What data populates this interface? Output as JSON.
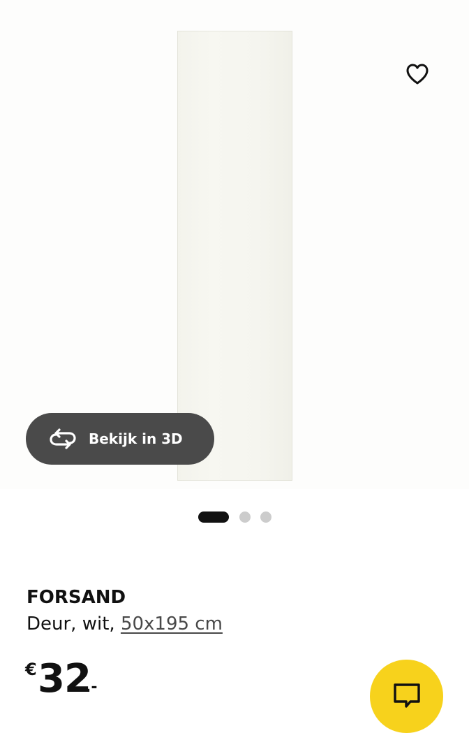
{
  "product_gallery": {
    "image_subject": "FORSAND door panel, white",
    "favorite_icon": "heart-outline-icon",
    "view_3d": {
      "label": "Bekijk in 3D",
      "icon": "rotate-3d-icon"
    },
    "carousel": {
      "total_images": 3,
      "active_index": 0
    }
  },
  "product": {
    "name": "FORSAND",
    "description_prefix": "Deur, wit, ",
    "size_link": "50x195 cm",
    "price": {
      "currency": "€",
      "integer": "32",
      "decimal": ".-"
    }
  },
  "chat": {
    "icon": "chat-bubble-icon",
    "color": "#f7d21c"
  },
  "colors": {
    "dark_pill": "#4a4a4a",
    "text": "#111111",
    "dot_inactive": "#cccccc",
    "accent_yellow": "#f7d21c"
  }
}
